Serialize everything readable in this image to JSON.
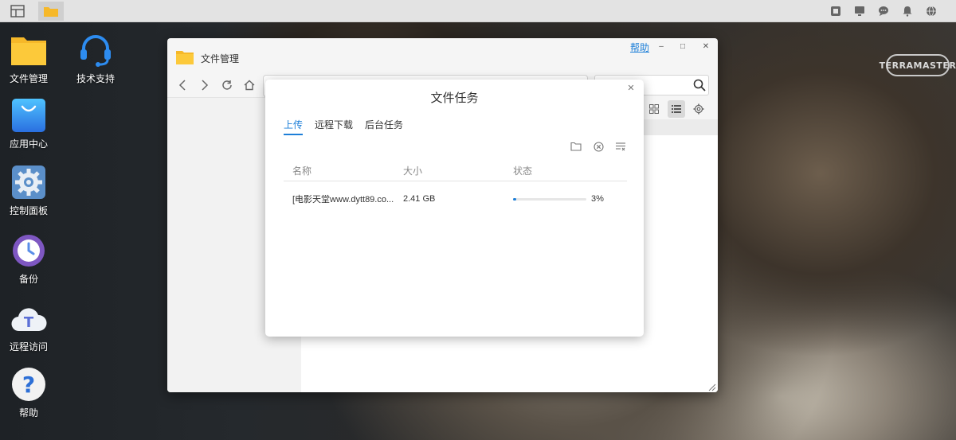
{
  "desktop": {
    "icons": [
      {
        "label": "文件管理",
        "icon": "folder-icon"
      },
      {
        "label": "技术支持",
        "icon": "headset-icon"
      },
      {
        "label": "应用中心",
        "icon": "shopping-bag-icon"
      },
      {
        "label": "控制面板",
        "icon": "gear-icon"
      },
      {
        "label": "备份",
        "icon": "clock-icon"
      },
      {
        "label": "远程访问",
        "icon": "cloud-t-icon"
      },
      {
        "label": "帮助",
        "icon": "question-icon"
      }
    ],
    "brand": "TERRAMASTER"
  },
  "taskbar": {
    "tray_icons": [
      "window-icon",
      "monitor-icon",
      "chat-icon",
      "bell-icon",
      "globe-icon"
    ]
  },
  "file_manager": {
    "title": "文件管理",
    "help_link": "帮助",
    "search_placeholder": "搜索"
  },
  "task_dialog": {
    "title": "文件任务",
    "tabs": [
      "上传",
      "远程下载",
      "后台任务"
    ],
    "active_tab": "上传",
    "columns": {
      "name": "名称",
      "size": "大小",
      "status": "状态"
    },
    "rows": [
      {
        "name": "[电影天堂www.dytt89.co...",
        "size": "2.41 GB",
        "progress": 0.03,
        "progress_text": "3%"
      }
    ]
  },
  "colors": {
    "accent": "#1d7fd8",
    "folder": "#f6b829"
  }
}
